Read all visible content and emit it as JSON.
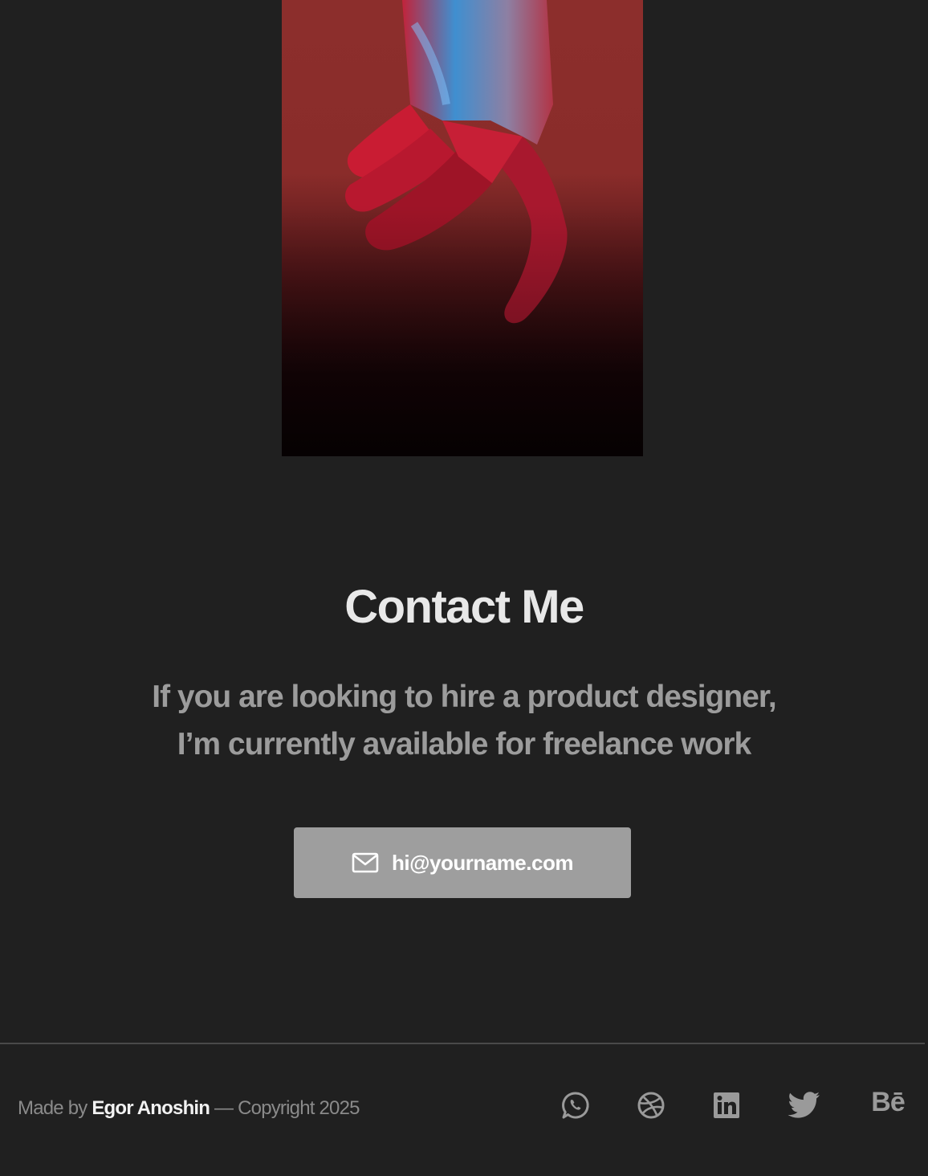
{
  "hero": {
    "image_alt": "hand photo",
    "colors": {
      "top": "#8c2e2c",
      "bottom": "#0d0204",
      "highlight": "#4aa9e0",
      "skin": "#d81e3a"
    }
  },
  "contact": {
    "title": "Contact Me",
    "description_line1": "If you are looking to hire a product designer,",
    "description_line2": "I’m currently available for freelance work",
    "email_icon": "mail-icon",
    "email_label": "hi@yourname.com"
  },
  "footer": {
    "made_by_prefix": "Made by ",
    "author": "Egor Anoshin",
    "copyright": " — Copyright 2025",
    "social": [
      {
        "icon": "whatsapp-icon"
      },
      {
        "icon": "dribbble-icon"
      },
      {
        "icon": "linkedin-icon"
      },
      {
        "icon": "twitter-icon"
      },
      {
        "icon": "behance-icon",
        "text": "Bē"
      }
    ]
  },
  "colors": {
    "background": "#202020",
    "heading": "#e8e8e8",
    "body_text": "#9c9c9c",
    "button_bg": "#9e9e9e",
    "icon": "#9a9a9a"
  }
}
